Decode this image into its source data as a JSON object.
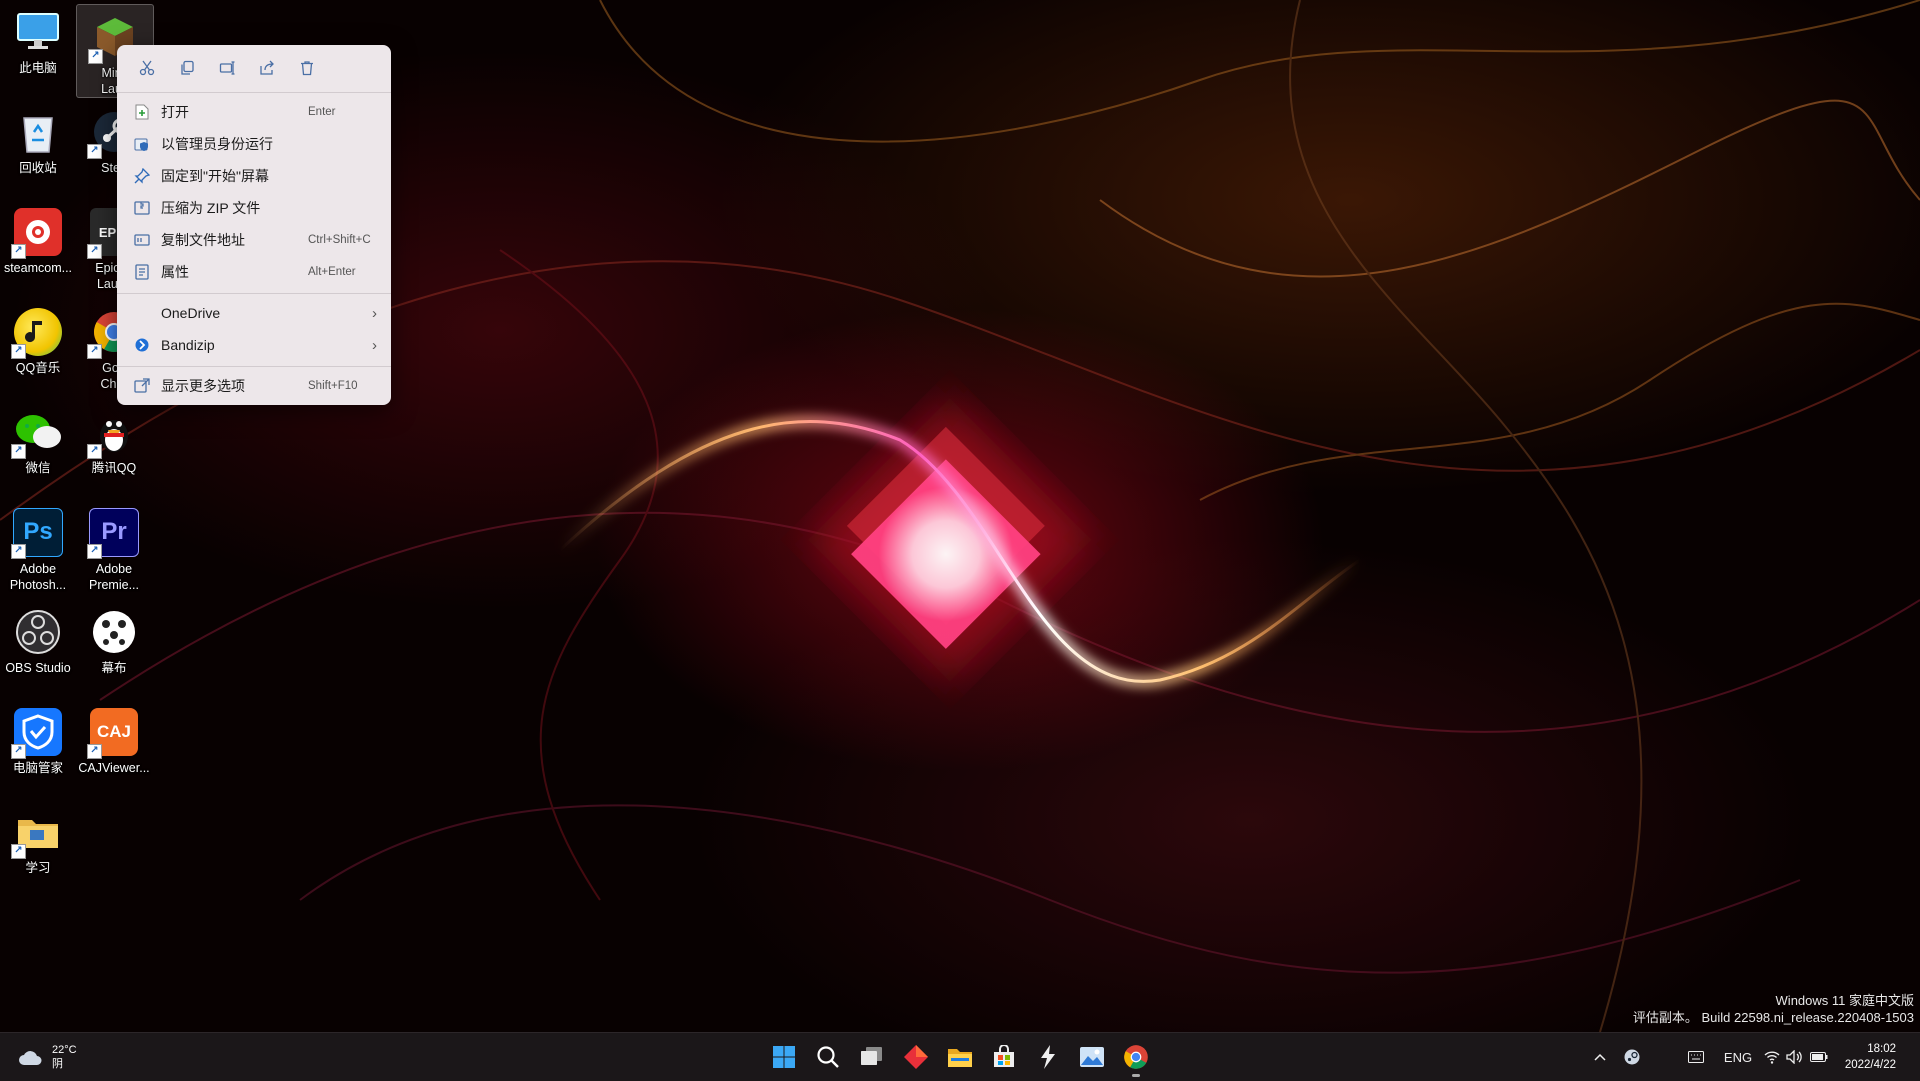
{
  "desktop": {
    "icons": [
      {
        "label": "此电脑"
      },
      {
        "label": "Mine\nLaun"
      },
      {
        "label": "回收站"
      },
      {
        "label": "Stea"
      },
      {
        "label": "steamcom..."
      },
      {
        "label": "Epic G\nLaunc"
      },
      {
        "label": "QQ音乐"
      },
      {
        "label": "Goo\nChro"
      },
      {
        "label": "微信"
      },
      {
        "label": "腾讯QQ"
      },
      {
        "label": "Adobe\nPhotosh..."
      },
      {
        "label": "Adobe\nPremie..."
      },
      {
        "label": "OBS Studio"
      },
      {
        "label": "幕布"
      },
      {
        "label": "电脑管家"
      },
      {
        "label": "CAJViewer..."
      },
      {
        "label": "学习"
      }
    ],
    "icon_glyphs": {
      "epic": "EPIC",
      "photoshop": "Ps",
      "premiere": "Pr",
      "caj": "CAJ"
    }
  },
  "context_menu": {
    "toolbar": [
      "cut-icon",
      "copy-icon",
      "rename-icon",
      "share-icon",
      "delete-icon"
    ],
    "items": [
      {
        "label": "打开",
        "shortcut": "Enter",
        "icon": "open-icon"
      },
      {
        "label": "以管理员身份运行",
        "shortcut": "",
        "icon": "admin-shield-icon"
      },
      {
        "label": "固定到\"开始\"屏幕",
        "shortcut": "",
        "icon": "pin-icon"
      },
      {
        "label": "压缩为 ZIP 文件",
        "shortcut": "",
        "icon": "zip-icon"
      },
      {
        "label": "复制文件地址",
        "shortcut": "Ctrl+Shift+C",
        "icon": "copy-path-icon"
      },
      {
        "label": "属性",
        "shortcut": "Alt+Enter",
        "icon": "properties-icon"
      },
      {
        "label": "OneDrive",
        "shortcut": "",
        "icon": "",
        "submenu": true
      },
      {
        "label": "Bandizip",
        "shortcut": "",
        "icon": "bandizip-icon",
        "submenu": true
      },
      {
        "label": "显示更多选项",
        "shortcut": "Shift+F10",
        "icon": "more-options-icon"
      }
    ]
  },
  "watermark": {
    "line1": "Windows 11 家庭中文版",
    "line2": "评估副本。 Build 22598.ni_release.220408-1503"
  },
  "taskbar": {
    "weather": {
      "temp": "22°C",
      "condition": "阴"
    },
    "apps": [
      "start-icon",
      "search-icon",
      "task-view-icon",
      "app-red-diamond-icon",
      "file-explorer-icon",
      "store-icon",
      "app-lightning-icon",
      "photos-icon",
      "chrome-icon"
    ],
    "tray": {
      "language": "ENG"
    },
    "clock": {
      "time": "18:02",
      "date": "2022/4/22"
    }
  },
  "colors": {
    "menu_bg": "#ede7ea",
    "taskbar_bg": "#1b1719",
    "accent_blue": "#2f6bb8"
  }
}
